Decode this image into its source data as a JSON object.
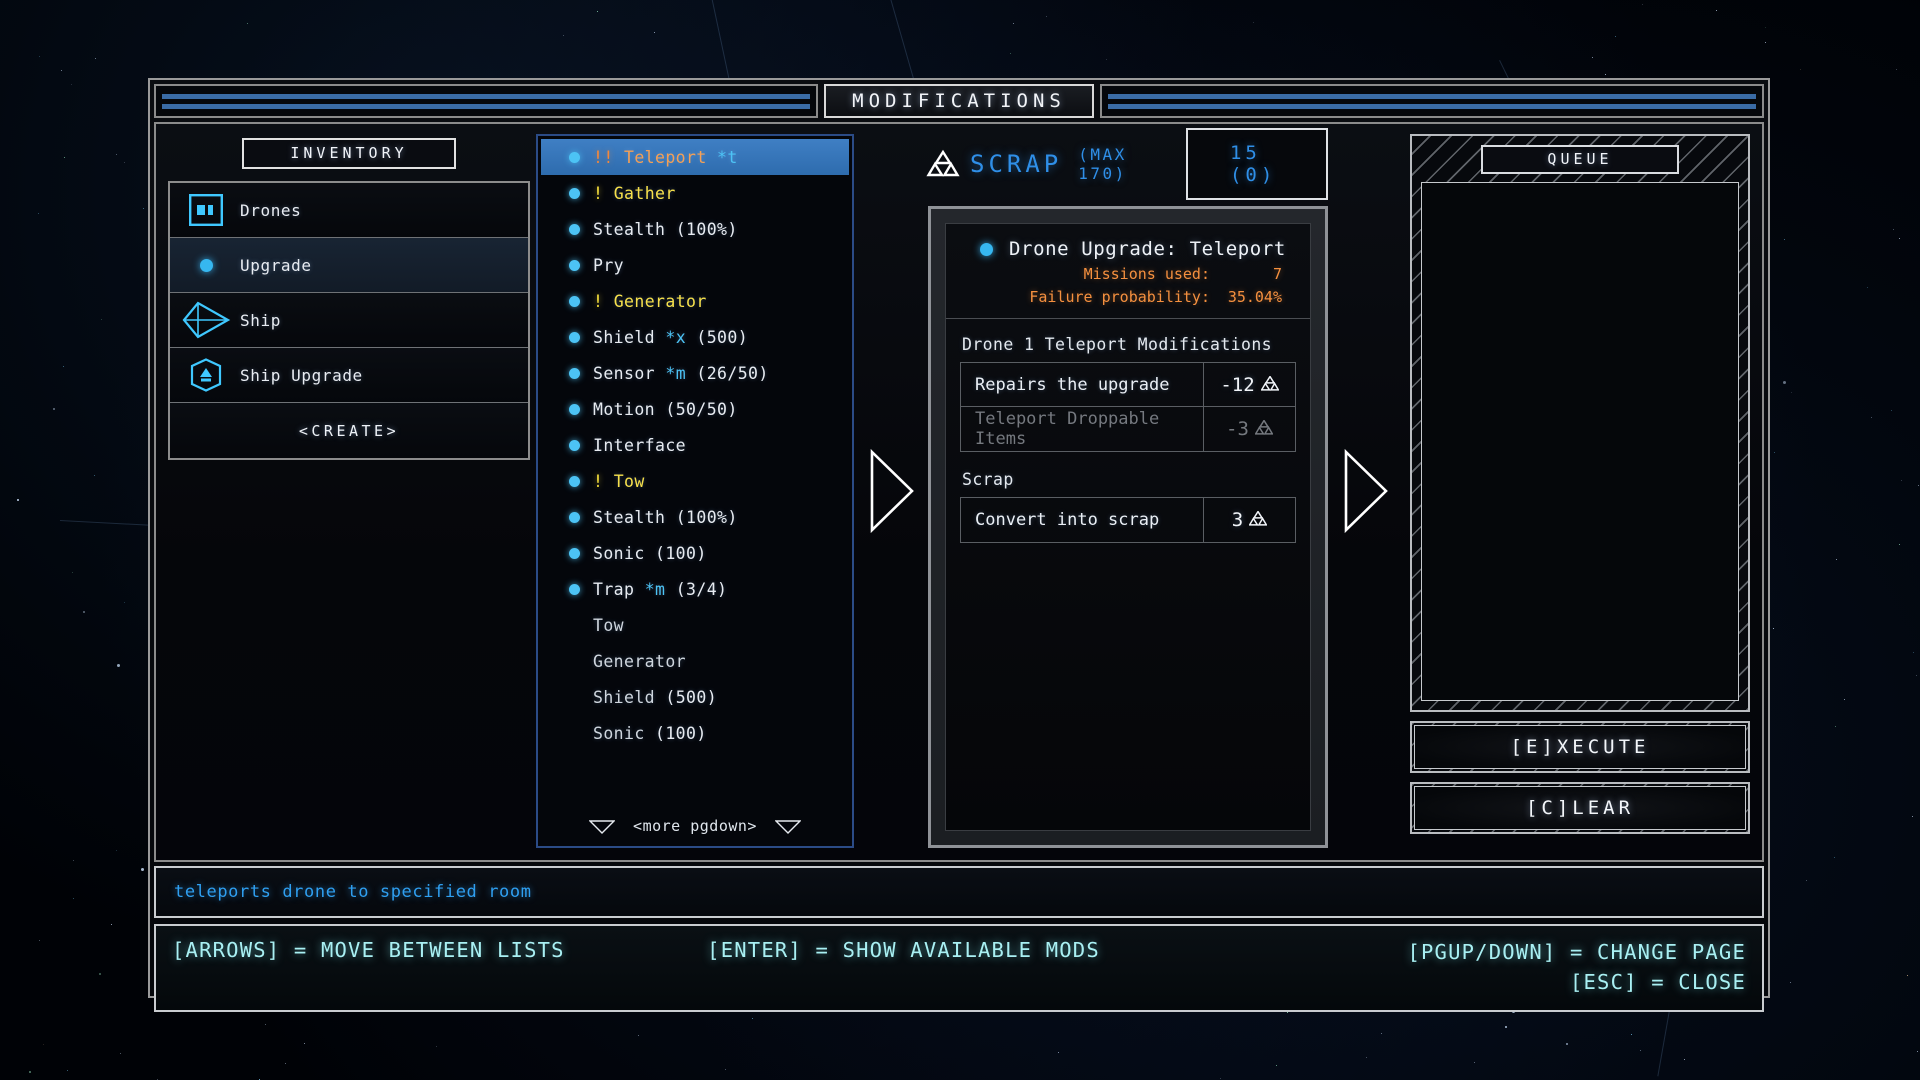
{
  "window": {
    "title": "MODIFICATIONS"
  },
  "inventory": {
    "header": "INVENTORY",
    "items": [
      {
        "label": "Drones",
        "icon": "drone-bay-icon",
        "selected": false
      },
      {
        "label": "Upgrade",
        "icon": "upgrade-dot-icon",
        "selected": true
      },
      {
        "label": "Ship",
        "icon": "ship-icon",
        "selected": false
      },
      {
        "label": "Ship Upgrade",
        "icon": "ship-upgrade-icon",
        "selected": false
      },
      {
        "label": "<CREATE>",
        "icon": "none",
        "selected": false
      }
    ]
  },
  "mod_list": {
    "more_label": "<more pgdown>",
    "items": [
      {
        "prefix": "!!",
        "name": "Teleport",
        "suffix": "*t",
        "bullet": true,
        "tone": "orange",
        "selected": true
      },
      {
        "prefix": "!",
        "name": "Gather",
        "suffix": "",
        "bullet": true,
        "tone": "yellow",
        "selected": false
      },
      {
        "prefix": "",
        "name": "Stealth",
        "suffix": "(100%)",
        "bullet": true,
        "tone": "plain",
        "selected": false
      },
      {
        "prefix": "",
        "name": "Pry",
        "suffix": "",
        "bullet": true,
        "tone": "plain",
        "selected": false
      },
      {
        "prefix": "!",
        "name": "Generator",
        "suffix": "",
        "bullet": true,
        "tone": "yellow",
        "selected": false
      },
      {
        "prefix": "",
        "name": "Shield",
        "suffix": "*x (500)",
        "bullet": true,
        "tone": "plain",
        "selected": false
      },
      {
        "prefix": "",
        "name": "Sensor",
        "suffix": "*m (26/50)",
        "bullet": true,
        "tone": "plain",
        "selected": false
      },
      {
        "prefix": "",
        "name": "Motion",
        "suffix": "(50/50)",
        "bullet": true,
        "tone": "plain",
        "selected": false
      },
      {
        "prefix": "",
        "name": "Interface",
        "suffix": "",
        "bullet": true,
        "tone": "plain",
        "selected": false
      },
      {
        "prefix": "!",
        "name": "Tow",
        "suffix": "",
        "bullet": true,
        "tone": "yellow",
        "selected": false
      },
      {
        "prefix": "",
        "name": "Stealth",
        "suffix": "(100%)",
        "bullet": true,
        "tone": "plain",
        "selected": false
      },
      {
        "prefix": "",
        "name": "Sonic",
        "suffix": "(100)",
        "bullet": true,
        "tone": "plain",
        "selected": false
      },
      {
        "prefix": "",
        "name": "Trap",
        "suffix": "*m (3/4)",
        "bullet": true,
        "tone": "plain",
        "selected": false
      },
      {
        "prefix": "",
        "name": "Tow",
        "suffix": "",
        "bullet": false,
        "tone": "plain",
        "selected": false
      },
      {
        "prefix": "",
        "name": "Generator",
        "suffix": "",
        "bullet": false,
        "tone": "plain",
        "selected": false
      },
      {
        "prefix": "",
        "name": "Shield",
        "suffix": "(500)",
        "bullet": false,
        "tone": "plain",
        "selected": false
      },
      {
        "prefix": "",
        "name": "Sonic",
        "suffix": "(100)",
        "bullet": false,
        "tone": "plain",
        "selected": false
      }
    ]
  },
  "scrap": {
    "icon": "scrap-trefoil-icon",
    "label": "SCRAP",
    "max_label": "(MAX 170)",
    "value": "15 (0)",
    "accent": "#2f8fe8"
  },
  "detail": {
    "title": "Drone Upgrade: Teleport",
    "stats": [
      {
        "label": "Missions used:",
        "value": "7"
      },
      {
        "label": "Failure probability:",
        "value": "35.04%"
      }
    ],
    "stat_color": "#f5903f",
    "groups": [
      {
        "label": "Drone 1 Teleport Modifications",
        "rows": [
          {
            "name": "Repairs the upgrade",
            "cost": "-12",
            "disabled": false
          },
          {
            "name": "Teleport Droppable Items",
            "cost": "-3",
            "disabled": true
          }
        ]
      },
      {
        "label": "Scrap",
        "rows": [
          {
            "name": "Convert into scrap",
            "cost": "3",
            "disabled": false
          }
        ]
      }
    ]
  },
  "queue": {
    "header": "QUEUE",
    "items": [],
    "execute_label": "[E]XECUTE",
    "clear_label": "[C]LEAR"
  },
  "description": "teleports drone to specified room",
  "help": {
    "arrows": "[ARROWS] = MOVE BETWEEN LISTS",
    "enter": "[ENTER] = SHOW AVAILABLE MODS",
    "pgupdown": "[PGUP/DOWN] = CHANGE PAGE",
    "esc": "[ESC] = CLOSE"
  }
}
